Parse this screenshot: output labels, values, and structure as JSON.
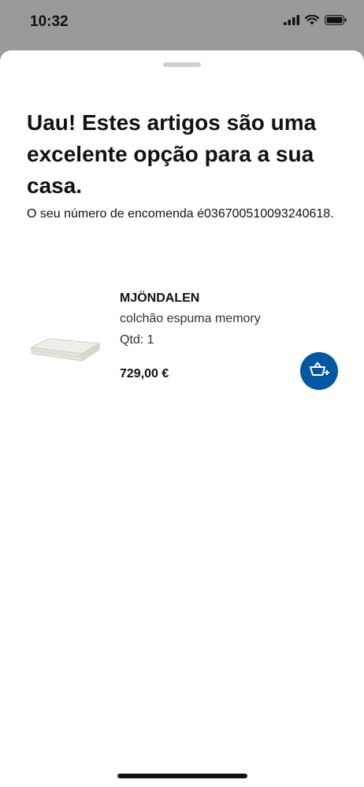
{
  "status_bar": {
    "time": "10:32"
  },
  "sheet": {
    "title": "Uau! Estes artigos são uma excelente opção para a sua casa.",
    "order_text": "O seu número de encomenda é036700510093240618."
  },
  "product": {
    "name": "MJÖNDALEN",
    "description": "colchão espuma memory",
    "quantity": "Qtd: 1",
    "price": "729,00 €"
  },
  "colors": {
    "accent": "#0058a3",
    "backdrop": "#9a9a9a"
  }
}
